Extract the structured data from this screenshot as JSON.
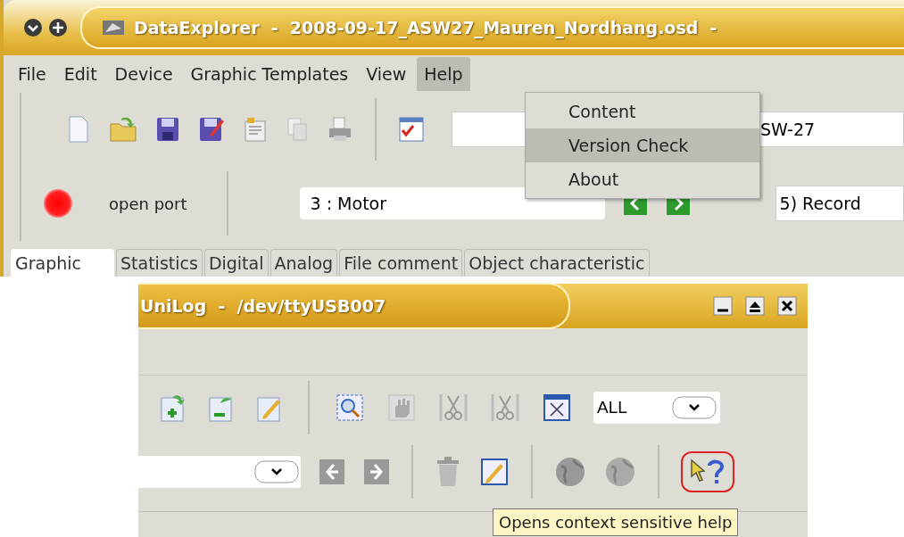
{
  "top_window": {
    "title": "DataExplorer  -  2008-09-17_ASW27_Mauren_Nordhang.osd  -",
    "menu": [
      {
        "label": "File",
        "selected": false
      },
      {
        "label": "Edit",
        "selected": false
      },
      {
        "label": "Device",
        "selected": false
      },
      {
        "label": "Graphic Templates",
        "selected": false
      },
      {
        "label": "View",
        "selected": false
      },
      {
        "label": "Help",
        "selected": true
      }
    ],
    "help_menu": [
      {
        "label": "Content",
        "selected": false
      },
      {
        "label": "Version Check",
        "selected": true
      },
      {
        "label": "About",
        "selected": false
      }
    ],
    "object_field": {
      "value": "SW-27"
    },
    "port_button": {
      "label": "open port"
    },
    "channel_select": {
      "value": "3 : Motor"
    },
    "record_select": {
      "value": "5) Record"
    },
    "tabs": [
      {
        "label": "Graphic",
        "selected": true
      },
      {
        "label": "Statistics",
        "selected": false
      },
      {
        "label": "Digital",
        "selected": false
      },
      {
        "label": "Analog",
        "selected": false
      },
      {
        "label": "File comment",
        "selected": false
      },
      {
        "label": "Object characteristic",
        "selected": false
      }
    ]
  },
  "bottom_window": {
    "title": "UniLog  -  /dev/ttyUSB007",
    "filter_select": {
      "value": "ALL"
    },
    "tooltip": "Opens context sensitive help"
  }
}
